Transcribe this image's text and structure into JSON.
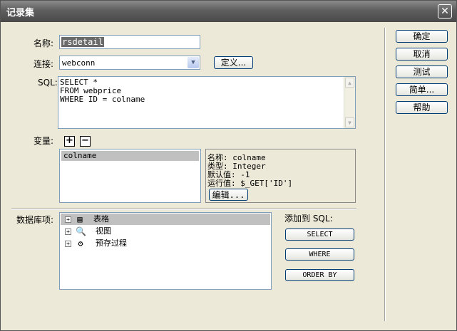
{
  "window": {
    "title": "记录集"
  },
  "form": {
    "name_label": "名称:",
    "name_value": "rsdetail",
    "connection_label": "连接:",
    "connection_value": "webconn",
    "define_button": "定义...",
    "sql_label": "SQL:",
    "sql_lines": [
      "SELECT *",
      "FROM webprice",
      "WHERE ID = colname"
    ],
    "variables_label": "变量:",
    "add_icon": "plus-icon",
    "remove_icon": "minus-icon"
  },
  "variables": {
    "items": [
      {
        "name": "colname",
        "selected": true
      }
    ],
    "detail": {
      "name_line": "名称: colname",
      "type_line": "类型: Integer",
      "default_line": "默认值: -1",
      "runtime_line": "运行值: $_GET['ID']"
    },
    "edit_button": "编辑..."
  },
  "database": {
    "label": "数据库项:",
    "items": [
      {
        "label": "表格",
        "icon": "table-icon",
        "selected": true
      },
      {
        "label": "视图",
        "icon": "view-icon"
      },
      {
        "label": "预存过程",
        "icon": "stored-procedure-icon"
      }
    ]
  },
  "add_to_sql": {
    "label": "添加到 SQL:",
    "select_button": "SELECT",
    "where_button": "WHERE",
    "orderby_button": "ORDER BY"
  },
  "side_buttons": {
    "ok": "确定",
    "cancel": "取消",
    "test": "测试",
    "simple": "简单...",
    "help": "帮助"
  },
  "colors": {
    "titlebar": "#5e5e5e",
    "dialog": "#ece9d8",
    "field_border": "#7f9db9",
    "selection": "#c0c0c0"
  }
}
